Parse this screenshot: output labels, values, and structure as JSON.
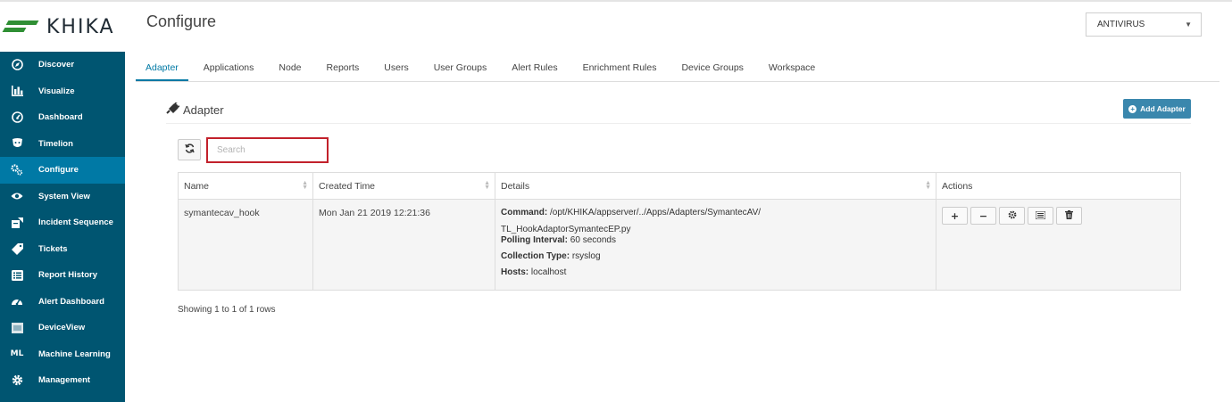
{
  "app": {
    "logo_text": "KHIKA",
    "page_title": "Configure",
    "top_select": "ANTIVIRUS"
  },
  "sidebar": {
    "items": [
      {
        "label": "Discover",
        "icon": "compass-icon"
      },
      {
        "label": "Visualize",
        "icon": "bar-chart-icon"
      },
      {
        "label": "Dashboard",
        "icon": "gauge-icon"
      },
      {
        "label": "Timelion",
        "icon": "shield-icon"
      },
      {
        "label": "Configure",
        "icon": "cogs-icon",
        "active": true
      },
      {
        "label": "System View",
        "icon": "eye-icon"
      },
      {
        "label": "Incident Sequence",
        "icon": "incident-icon"
      },
      {
        "label": "Tickets",
        "icon": "tag-icon"
      },
      {
        "label": "Report History",
        "icon": "list-icon"
      },
      {
        "label": "Alert Dashboard",
        "icon": "alert-gauge-icon"
      },
      {
        "label": "DeviceView",
        "icon": "device-icon"
      },
      {
        "label": "Machine Learning",
        "icon": "ml-text-icon",
        "glyph": "ML"
      },
      {
        "label": "Management",
        "icon": "gear-icon"
      }
    ]
  },
  "tabs": [
    "Adapter",
    "Applications",
    "Node",
    "Reports",
    "Users",
    "User Groups",
    "Alert Rules",
    "Enrichment Rules",
    "Device Groups",
    "Workspace"
  ],
  "section": {
    "title": "Adapter",
    "add_button": "Add Adapter"
  },
  "search": {
    "placeholder": "Search",
    "value": ""
  },
  "table": {
    "columns": [
      "Name",
      "Created Time",
      "Details",
      "Actions"
    ],
    "rows": [
      {
        "name": "symantecav_hook",
        "created": "Mon Jan 21 2019 12:21:36",
        "command_label": "Command:",
        "command_value": "/opt/KHIKA/appserver/../Apps/Adapters/SymantecAV/",
        "command_cont": "TL_HookAdaptorSymantecEP.py",
        "polling_label": "Polling Interval:",
        "polling_value": "60 seconds",
        "collection_label": "Collection Type:",
        "collection_value": "rsyslog",
        "hosts_label": "Hosts:",
        "hosts_value": "localhost"
      }
    ]
  },
  "footer": {
    "row_count": "Showing 1 to 1 of 1 rows"
  }
}
